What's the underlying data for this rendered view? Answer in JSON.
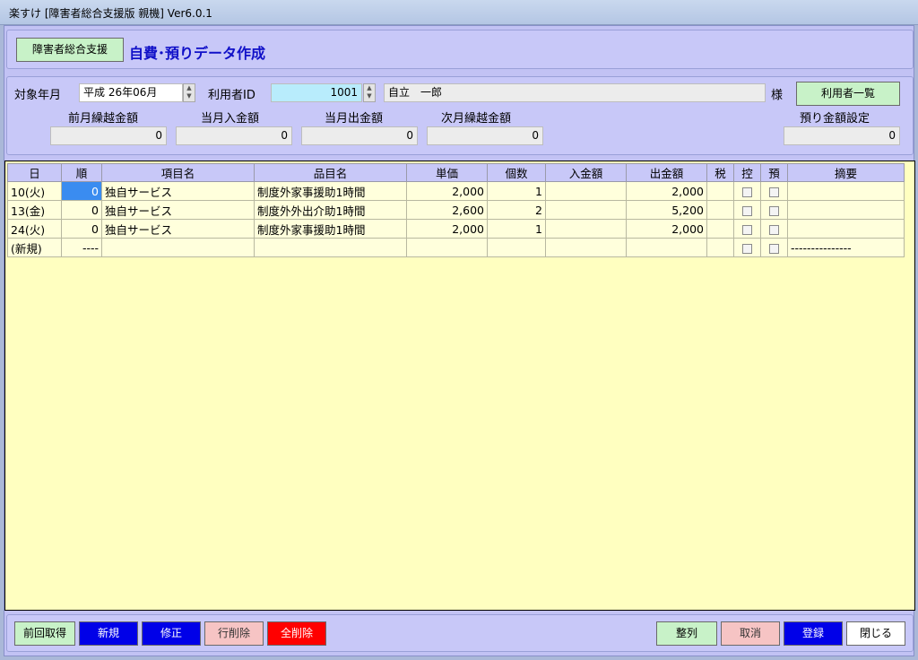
{
  "window": {
    "title": "楽すけ [障害者総合支援版 親機] Ver6.0.1"
  },
  "header": {
    "system_button": "障害者総合支援",
    "screen_title": "自費･預りデータ作成"
  },
  "info": {
    "target_month_label": "対象年月",
    "target_month_value": "平成 26年06月",
    "user_id_label": "利用者ID",
    "user_id_value": "1001",
    "user_name": "自立　一郎",
    "honorific": "様",
    "user_list_button": "利用者一覧",
    "prev_balance_label": "前月繰越金額",
    "prev_balance_value": "0",
    "month_in_label": "当月入金額",
    "month_in_value": "0",
    "month_out_label": "当月出金額",
    "month_out_value": "0",
    "next_balance_label": "次月繰越金額",
    "next_balance_value": "0",
    "deposit_setting_label": "預り金額設定",
    "deposit_setting_value": "0"
  },
  "grid": {
    "headers": [
      "日",
      "順",
      "項目名",
      "品目名",
      "単価",
      "個数",
      "入金額",
      "出金額",
      "税",
      "控",
      "預",
      "摘要"
    ],
    "rows": [
      {
        "day": "10(火)",
        "order": "0",
        "item": "独自サービス",
        "product": "制度外家事援助1時間",
        "price": "2,000",
        "qty": "1",
        "in": "",
        "out": "2,000",
        "tax": "",
        "memo": ""
      },
      {
        "day": "13(金)",
        "order": "0",
        "item": "独自サービス",
        "product": "制度外外出介助1時間",
        "price": "2,600",
        "qty": "2",
        "in": "",
        "out": "5,200",
        "tax": "",
        "memo": ""
      },
      {
        "day": "24(火)",
        "order": "0",
        "item": "独自サービス",
        "product": "制度外家事援助1時間",
        "price": "2,000",
        "qty": "1",
        "in": "",
        "out": "2,000",
        "tax": "",
        "memo": ""
      },
      {
        "day": "(新規)",
        "order": "----",
        "item": "",
        "product": "",
        "price": "",
        "qty": "",
        "in": "",
        "out": "",
        "tax": "",
        "memo": "---------------"
      }
    ]
  },
  "footer": {
    "prev_fetch": "前回取得",
    "new": "新規",
    "edit": "修正",
    "delete_row": "行削除",
    "delete_all": "全削除",
    "sort": "整列",
    "cancel": "取消",
    "register": "登録",
    "close": "閉じる"
  }
}
